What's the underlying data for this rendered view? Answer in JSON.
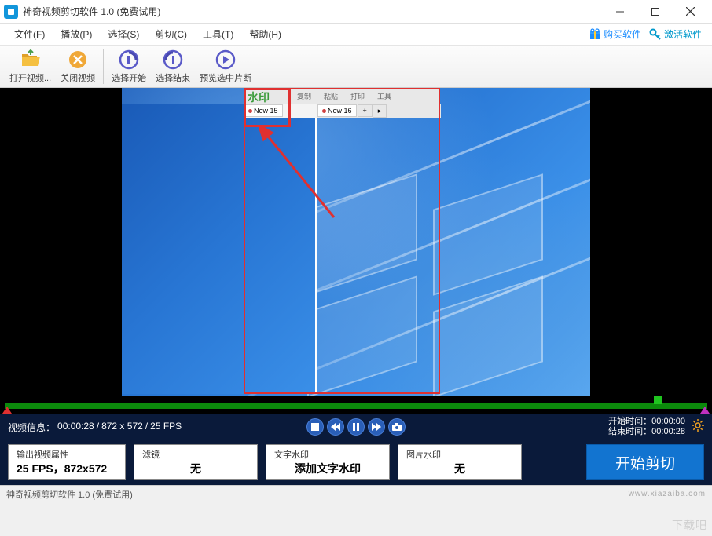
{
  "title": "神奇视频剪切软件 1.0 (免费试用)",
  "menu": {
    "file": "文件(F)",
    "play": "播放(P)",
    "select": "选择(S)",
    "cut": "剪切(C)",
    "tools": "工具(T)",
    "help": "帮助(H)",
    "buy": "购买软件",
    "activate": "激活软件"
  },
  "toolbar": {
    "open": "打开视频...",
    "close": "关闭视频",
    "selstart": "选择开始",
    "selend": "选择结束",
    "preview": "预览选中片断"
  },
  "overlay": {
    "watermark": "水印",
    "cmd1": "复制",
    "cmd2": "粘贴",
    "cmd3": "打印",
    "cmd4": "工具",
    "tab1": "New 15",
    "tab2": "New 16",
    "plus": "+"
  },
  "controls": {
    "info_label": "视频信息：",
    "duration": "00:00:28",
    "resolution": "872 x 572",
    "fps": "25 FPS",
    "start_label": "开始时间：",
    "start_val": "00:00:00",
    "end_label": "结束时间：",
    "end_val": "00:00:28"
  },
  "props": {
    "output_label": "输出视频属性",
    "output_val": "25 FPS，872x572",
    "filter_label": "滤镜",
    "filter_val": "无",
    "textwm_label": "文字水印",
    "textwm_val": "添加文字水印",
    "imgwm_label": "图片水印",
    "imgwm_val": "无",
    "cut_btn": "开始剪切"
  },
  "status": "神奇视频剪切软件 1.0 (免费试用)",
  "corner": "下载吧"
}
